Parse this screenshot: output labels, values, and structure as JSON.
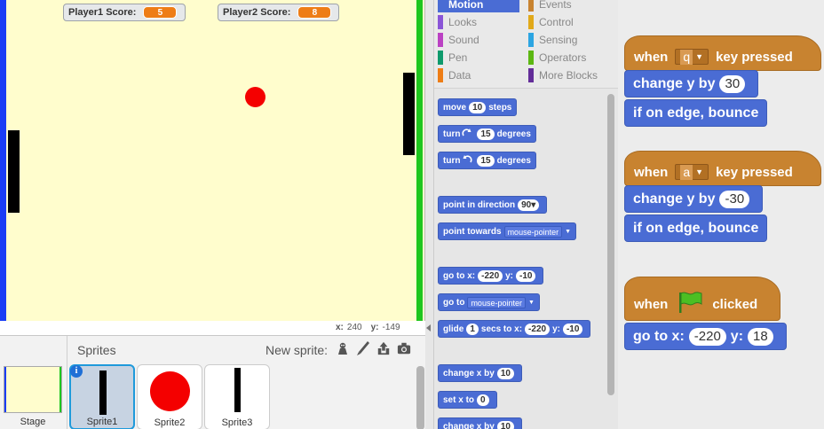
{
  "stage": {
    "monitors": [
      {
        "label": "Player1 Score:",
        "value": "5"
      },
      {
        "label": "Player2 Score:",
        "value": "8"
      }
    ],
    "coords": {
      "x_label": "x:",
      "x_value": "240",
      "y_label": "y:",
      "y_value": "-149"
    }
  },
  "sprites_pane": {
    "title": "Sprites",
    "new_sprite_label": "New sprite:",
    "stage_label": "Stage",
    "info_glyph": "i",
    "tiles": [
      {
        "label": "Sprite1",
        "selected": true
      },
      {
        "label": "Sprite2",
        "selected": false
      },
      {
        "label": "Sprite3",
        "selected": false
      }
    ]
  },
  "palette": {
    "categories": [
      {
        "label": "Motion",
        "color": "#4a6cd4",
        "selected": true
      },
      {
        "label": "Events",
        "color": "#c88330"
      },
      {
        "label": "Looks",
        "color": "#8a55d7"
      },
      {
        "label": "Control",
        "color": "#e1a91a"
      },
      {
        "label": "Sound",
        "color": "#bb42c3"
      },
      {
        "label": "Sensing",
        "color": "#2ca5e2"
      },
      {
        "label": "Pen",
        "color": "#0e9a6c"
      },
      {
        "label": "Operators",
        "color": "#5cb712"
      },
      {
        "label": "Data",
        "color": "#ee7d16"
      },
      {
        "label": "More Blocks",
        "color": "#632d99"
      }
    ],
    "blocks": {
      "move": {
        "pre": "move",
        "val": "10",
        "post": "steps"
      },
      "turn_right": {
        "pre": "turn",
        "val": "15",
        "post": "degrees"
      },
      "turn_left": {
        "pre": "turn",
        "val": "15",
        "post": "degrees"
      },
      "point_dir": {
        "pre": "point in direction",
        "val": "90▾"
      },
      "point_towards": {
        "pre": "point towards",
        "val": "mouse-pointer"
      },
      "goto_xy": {
        "pre": "go to x:",
        "x": "-220",
        "mid": "y:",
        "y": "-10"
      },
      "goto": {
        "pre": "go to",
        "val": "mouse-pointer"
      },
      "glide": {
        "pre": "glide",
        "secs": "1",
        "mid": "secs to x:",
        "x": "-220",
        "mid2": "y:",
        "y": "-10"
      },
      "change_x": {
        "pre": "change x by",
        "val": "10"
      },
      "set_x": {
        "pre": "set x to",
        "val": "0"
      },
      "change_y_partial": {
        "pre": "change x by",
        "val": "10"
      }
    }
  },
  "scripts": {
    "script1": {
      "when": "when",
      "key": "q",
      "pressed": "key pressed",
      "change": "change y by",
      "change_val": "30",
      "bounce": "if on edge, bounce"
    },
    "script2": {
      "when": "when",
      "key": "a",
      "pressed": "key pressed",
      "change": "change y by",
      "change_val": "-30",
      "bounce": "if on edge, bounce"
    },
    "script3": {
      "when": "when",
      "clicked": "clicked",
      "goto": "go to x:",
      "x": "-220",
      "y_label": "y:",
      "y": "18"
    }
  },
  "colors": {
    "motion": "#4a6cd4",
    "events": "#c88330",
    "stage_bg": "#fffdcd",
    "ball": "#f40000",
    "left_wall": "#1a3df5",
    "right_wall": "#1ec61e"
  },
  "icons": [
    "choose-sprite-icon",
    "paint-brush-icon",
    "upload-icon",
    "camera-icon",
    "flag-icon",
    "turn-right-icon",
    "turn-left-icon",
    "dropdown-arrow-icon"
  ]
}
